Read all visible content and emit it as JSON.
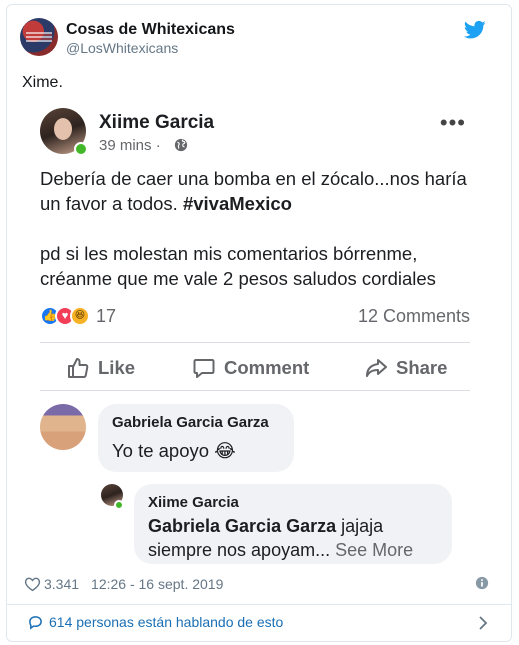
{
  "tweet": {
    "account_name": "Cosas de Whitexicans",
    "handle": "@LosWhitexicans",
    "text": "Xime.",
    "likes": "3.341",
    "timestamp": "12:26 - 16 sept. 2019",
    "footer_text": "614 personas están hablando de esto"
  },
  "fb_post": {
    "author": "Xiime Garcia",
    "time": "39 mins ·",
    "body_line1": "Debería de caer una bomba en el zócalo...nos haría un favor a todos. ",
    "hashtag": "#vivaMexico",
    "body_line2": "pd si les molestan mis comentarios bórrenme, créanme que me vale 2 pesos  saludos cordiales",
    "reaction_count": "17",
    "comments_count": "12 Comments",
    "actions": {
      "like": "Like",
      "comment": "Comment",
      "share": "Share"
    },
    "comments": [
      {
        "author": "Gabriela Garcia Garza",
        "text": "Yo te apoyo 😂"
      },
      {
        "author": "Xiime Garcia",
        "mention": "Gabriela Garcia Garza",
        "text": " jajaja siempre nos apoyam... ",
        "see_more": "See More"
      }
    ]
  },
  "icons": {
    "twitter": "twitter-bird-icon",
    "globe": "globe-icon",
    "more": "more-options-icon",
    "like": "thumbs-up-icon",
    "comment": "comment-bubble-icon",
    "share": "share-arrow-icon",
    "heart": "heart-icon",
    "info": "info-icon",
    "chevron": "chevron-right-icon"
  },
  "colors": {
    "twitter_blue": "#1da1f2",
    "link_blue": "#1b6fb4",
    "fb_like": "#1877f2",
    "fb_love": "#f33e58",
    "fb_haha": "#f7b125",
    "online_green": "#42b72a"
  }
}
